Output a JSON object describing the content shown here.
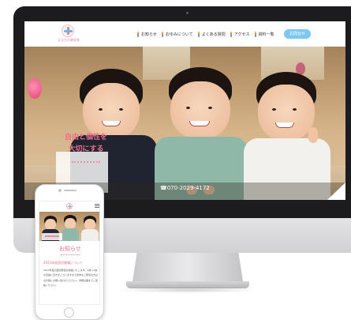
{
  "site": {
    "logo_text": "まなびの森保育",
    "nav_items": [
      {
        "label": "お知らせ"
      },
      {
        "label": "おゆみについて"
      },
      {
        "label": "よくある質問"
      },
      {
        "label": "アクセス"
      },
      {
        "label": "資料一覧"
      }
    ],
    "contact_label": "お問合せ",
    "hero_catch_line1": "自由と個性を",
    "hero_catch_line2": "大切にする",
    "phone_number": "☎070-2029-4172"
  },
  "mobile": {
    "news_title": "お知らせ",
    "news_headline": "2023年度園児募集について",
    "news_body": "2023年度の園児募集を開始いたします。1歳〜2歳の定員に空きがございますので見学をご希望の方はお気軽にお問い合わせください。詳細は園までご連絡ください。"
  },
  "colors": {
    "accent_pink": "#ef6f8e",
    "accent_blue": "#7cc8f2",
    "frame": "#1c1c1e"
  }
}
